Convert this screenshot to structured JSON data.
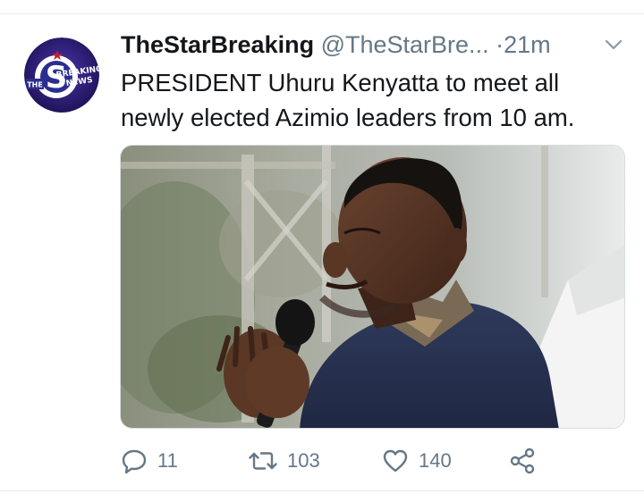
{
  "tweet": {
    "avatar": {
      "icon": "breaking-news-logo-icon",
      "logo_text": [
        "THE",
        "BREAKING",
        "NEWS"
      ],
      "colors": {
        "ring": "#3a1f7a",
        "inner": "#2b2e8f",
        "accent": "#c8202e"
      }
    },
    "display_name": "TheStarBreaking",
    "handle": "@TheStarBre...",
    "separator": "·",
    "timestamp": "21m",
    "text_lines": [
      "PRESIDENT Uhuru Kenyatta to meet all",
      "newly elected Azimio leaders from 10 am."
    ],
    "media": {
      "type": "photo",
      "icon": "photo-man-speaking-microphone-icon"
    },
    "actions": {
      "reply": {
        "icon": "reply-icon",
        "count": "11"
      },
      "retweet": {
        "icon": "retweet-icon",
        "count": "103"
      },
      "like": {
        "icon": "heart-icon",
        "count": "140"
      },
      "share": {
        "icon": "share-icon"
      }
    },
    "menu_icon": "chevron-down-icon"
  },
  "colors": {
    "text_primary": "#14171a",
    "text_secondary": "#657786",
    "divider": "#e6ecf0"
  }
}
